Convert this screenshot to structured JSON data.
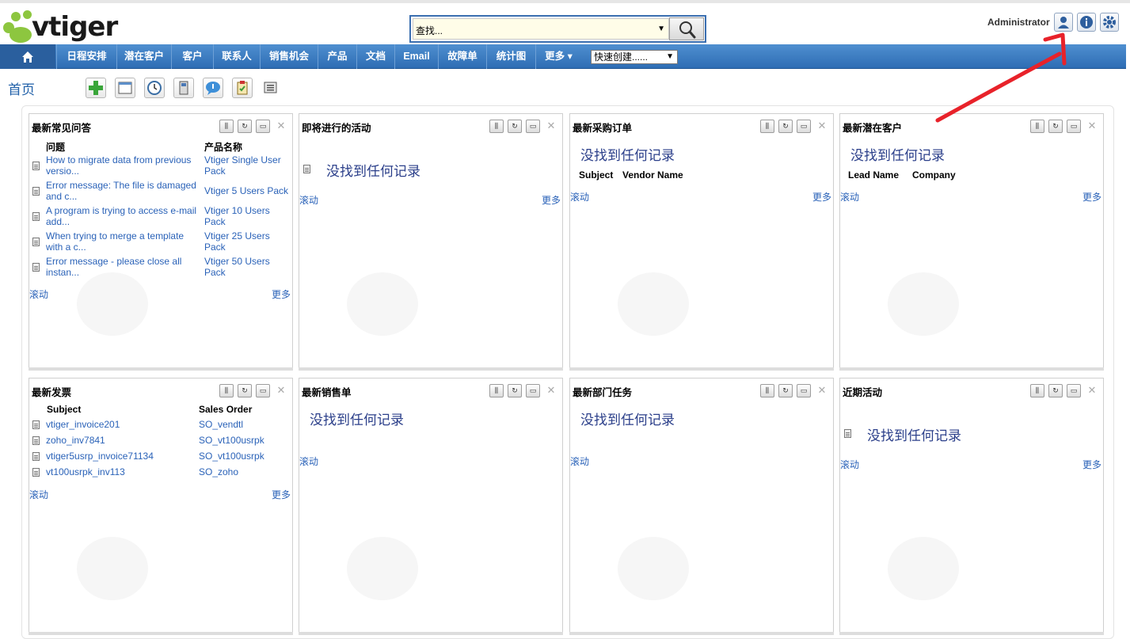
{
  "header": {
    "logo_text": "vtiger",
    "search_placeholder": "查找...",
    "user_name": "Administrator"
  },
  "nav": {
    "items": [
      "日程安排",
      "潜在客户",
      "客户",
      "联系人",
      "销售机会",
      "产品",
      "文档",
      "Email",
      "故障单",
      "统计图",
      "更多 ▾"
    ],
    "quick_create": "快速创建......"
  },
  "page": {
    "title": "首页"
  },
  "widgets": {
    "faq": {
      "title": "最新常见问答",
      "col1": "问题",
      "col2": "产品名称",
      "rows": [
        {
          "q1": "How to migrate data from previous",
          "q2": "versio...",
          "p1": "Vtiger Single User",
          "p2": "Pack"
        },
        {
          "q1": "Error message: The file is damaged",
          "q2": "and c...",
          "p1": "Vtiger 5 Users Pack",
          "p2": ""
        },
        {
          "q1": "A program is trying to access e-mail",
          "q2": "add...",
          "p1": "Vtiger 10 Users",
          "p2": "Pack"
        },
        {
          "q1": "When trying to merge a template",
          "q2": "with a c...",
          "p1": "Vtiger 25 Users",
          "p2": "Pack"
        },
        {
          "q1": "Error message - please close all",
          "q2": "instan...",
          "p1": "Vtiger 50 Users",
          "p2": "Pack"
        }
      ],
      "scroll": "滚动",
      "more": "更多"
    },
    "activities": {
      "title": "即将进行的活动",
      "empty": "没找到任何记录",
      "scroll": "滚动",
      "more": "更多"
    },
    "po": {
      "title": "最新采购订单",
      "empty": "没找到任何记录",
      "col1": "Subject",
      "col2": "Vendor Name",
      "scroll": "滚动",
      "more": "更多"
    },
    "leads": {
      "title": "最新潜在客户",
      "empty": "没找到任何记录",
      "col1": "Lead Name",
      "col2": "Company",
      "scroll": "滚动",
      "more": "更多"
    },
    "invoices": {
      "title": "最新发票",
      "col1": "Subject",
      "col2": "Sales Order",
      "rows": [
        {
          "subject": "vtiger_invoice201",
          "so": "SO_vendtl"
        },
        {
          "subject": "zoho_inv7841",
          "so": "SO_vt100usrpk"
        },
        {
          "subject": "vtiger5usrp_invoice71134",
          "so": "SO_vt100usrpk"
        },
        {
          "subject": "vt100usrpk_inv113",
          "so": "SO_zoho"
        }
      ],
      "scroll": "滚动",
      "more": "更多"
    },
    "sales_orders": {
      "title": "最新销售单",
      "empty": "没找到任何记录",
      "scroll": "滚动"
    },
    "group_tasks": {
      "title": "最新部门任务",
      "empty": "没找到任何记录",
      "scroll": "滚动"
    },
    "recent_activities": {
      "title": "近期活动",
      "empty": "没找到任何记录",
      "scroll": "滚动",
      "more": "更多"
    }
  },
  "colors": {
    "nav_blue": "#2e6db4",
    "link_blue": "#2a62b8",
    "empty_text": "#2b3f8a",
    "logo_green": "#8dc63f",
    "arrow_red": "#e8222a"
  }
}
